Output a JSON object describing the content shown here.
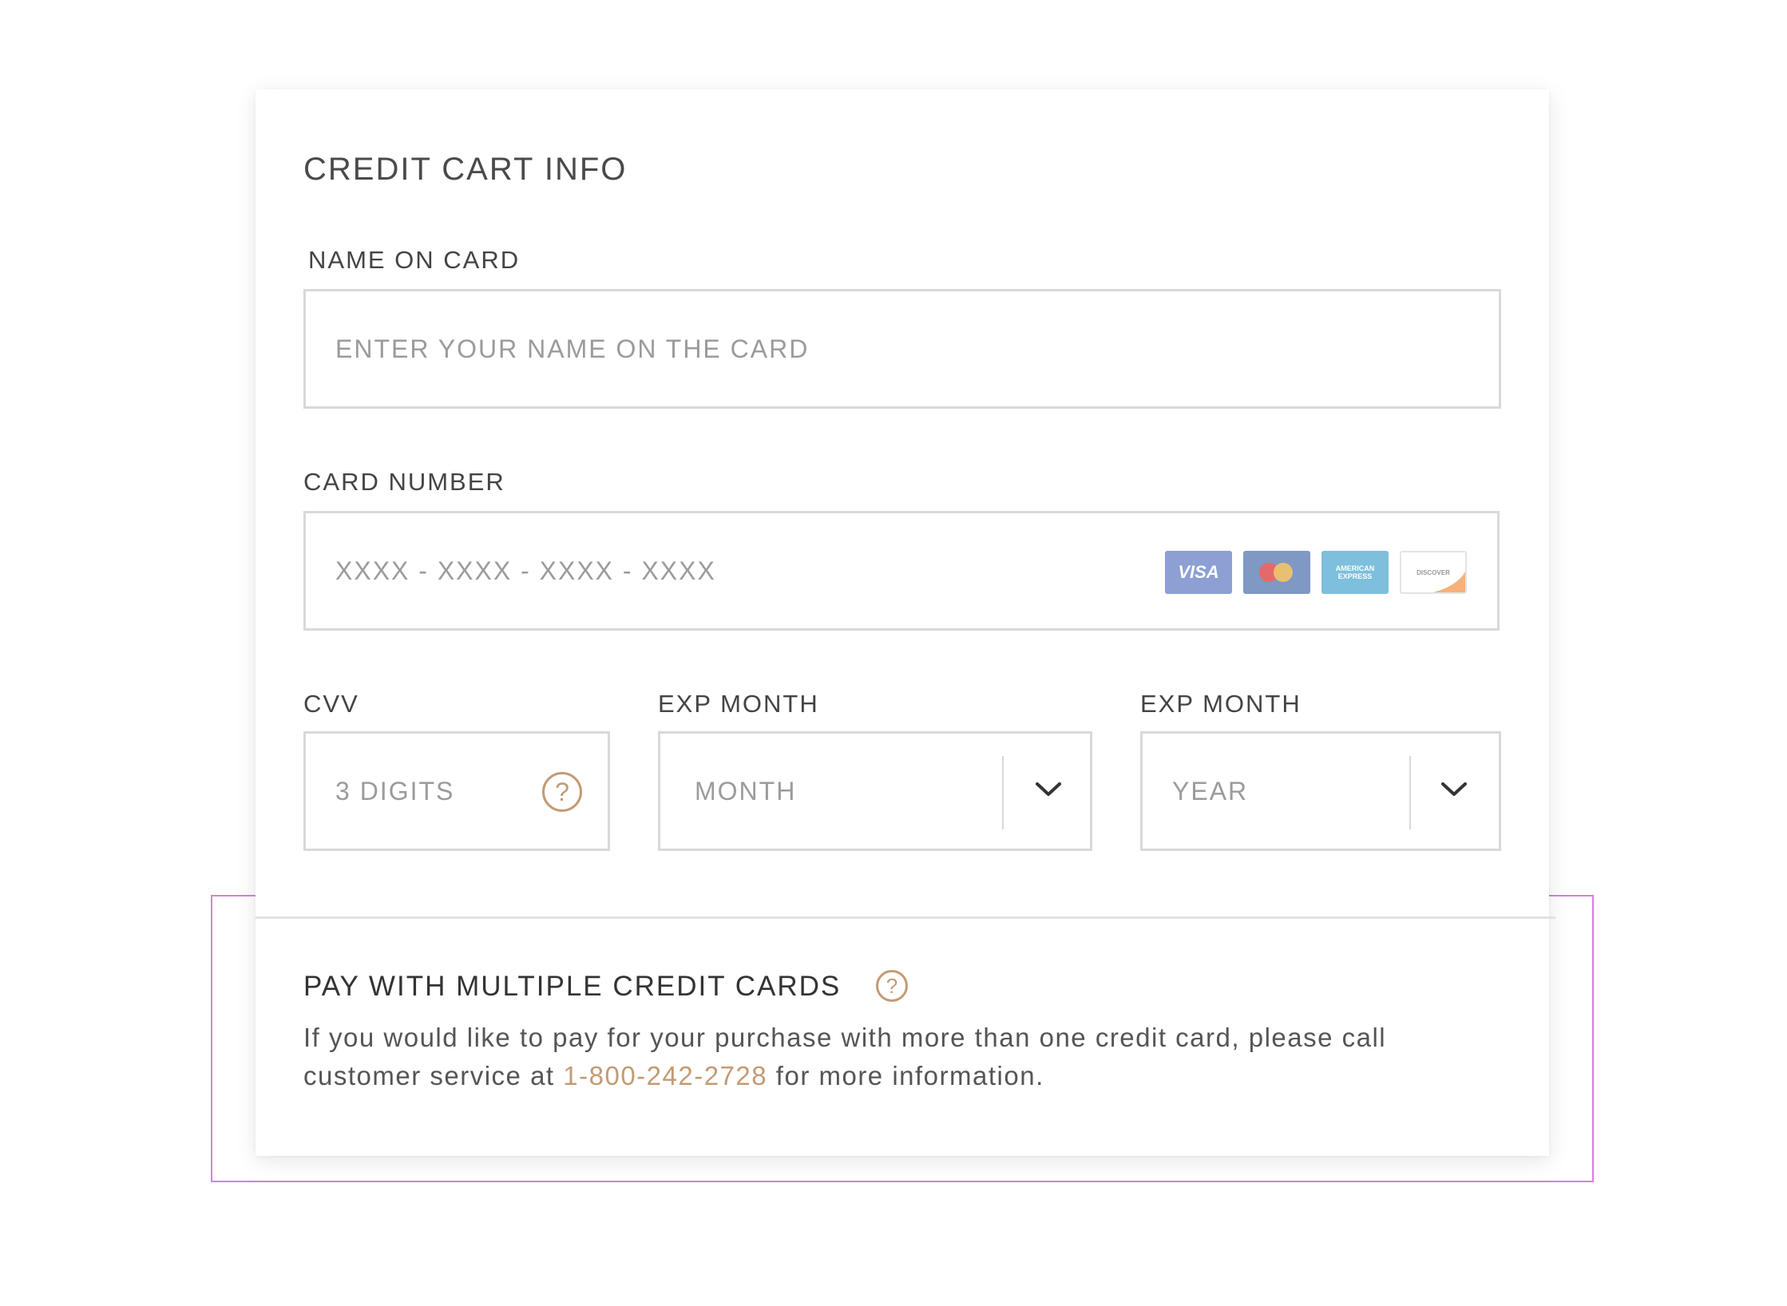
{
  "form": {
    "title": "CREDIT CART INFO",
    "name_label": "NAME ON CARD",
    "name_placeholder": "ENTER YOUR NAME ON THE CARD",
    "number_label": "CARD NUMBER",
    "number_placeholder": "XXXX - XXXX - XXXX - XXXX",
    "card_logos": [
      {
        "name": "visa-logo",
        "text": "VISA",
        "color": "#8d9fd3"
      },
      {
        "name": "mastercard-logo",
        "text": "",
        "color": "#7f98c4"
      },
      {
        "name": "amex-logo",
        "text": "AMERICAN EXPRESS",
        "color": "#7dbfdc"
      },
      {
        "name": "discover-logo",
        "text": "DISCOVER",
        "color": "#ffffff"
      }
    ],
    "cvv_label": "CVV",
    "cvv_placeholder": "3 DIGITS",
    "cvv_help_icon": "question-circle-icon",
    "exp_month_label": "EXP MONTH",
    "exp_month_value": "MONTH",
    "exp_year_label": "EXP MONTH",
    "exp_year_value": "YEAR"
  },
  "multi_card": {
    "title": "PAY WITH MULTIPLE CREDIT CARDS",
    "help_icon": "question-circle-icon",
    "text_before": "If you would like to pay for your purchase with more than one credit card, please call customer service at ",
    "phone": "1-800-242-2728",
    "text_after": " for more information."
  },
  "colors": {
    "accent": "#c39b73",
    "highlight_border": "#e07be0",
    "field_border": "#d9d9d9"
  },
  "help_glyph": "?"
}
